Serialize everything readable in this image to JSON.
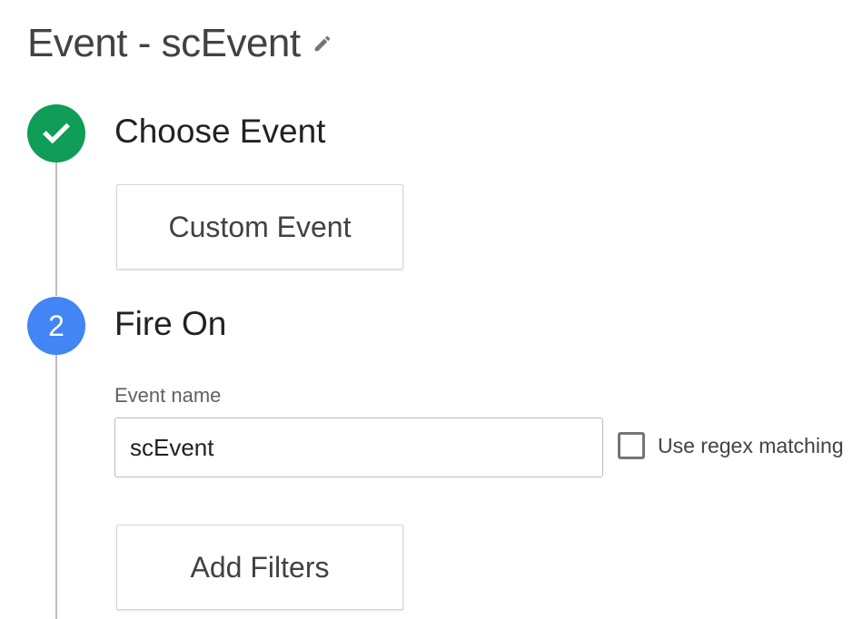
{
  "header": {
    "title": "Event - scEvent",
    "edit_icon": "pencil-icon"
  },
  "colors": {
    "step_complete": "#0f9d58",
    "step_active": "#4285f4",
    "timeline": "#bdbdbd"
  },
  "steps": [
    {
      "status": "complete",
      "icon": "checkmark-icon",
      "title": "Choose Event",
      "card_label": "Custom Event"
    },
    {
      "status": "active",
      "number": "2",
      "title": "Fire On",
      "field_label": "Event name",
      "field_value": "scEvent",
      "checkbox_label": "Use regex matching",
      "checkbox_checked": false,
      "card_label": "Add Filters"
    }
  ]
}
